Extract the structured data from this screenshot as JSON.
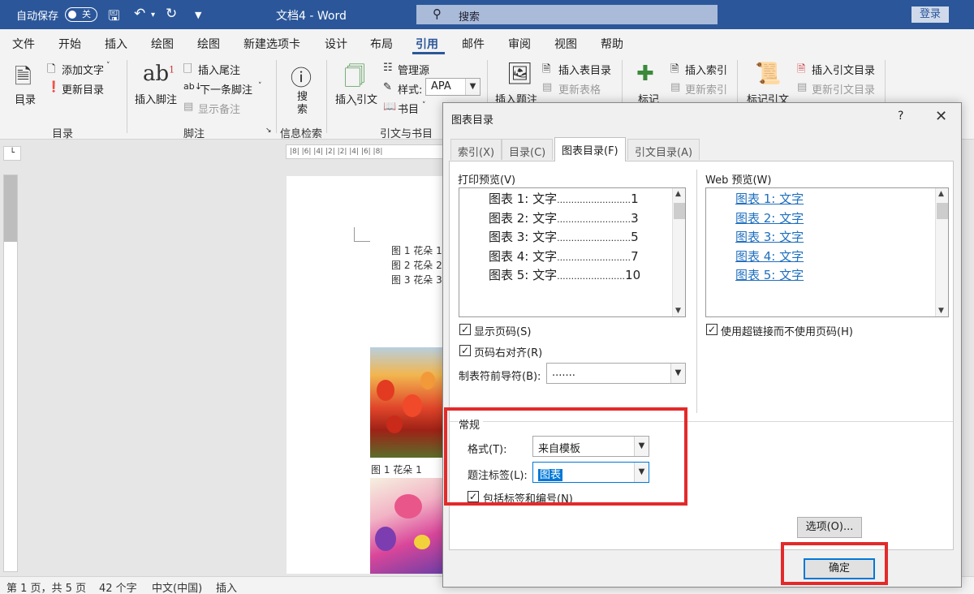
{
  "titlebar": {
    "autosave_label": "自动保存",
    "autosave_state": "关",
    "doc_title": "文档4 - Word",
    "search_placeholder": "搜索",
    "login": "登录"
  },
  "menu": {
    "items": [
      "文件",
      "开始",
      "插入",
      "绘图",
      "绘图",
      "新建选项卡",
      "设计",
      "布局",
      "引用",
      "邮件",
      "审阅",
      "视图",
      "帮助"
    ],
    "active_index": 8
  },
  "ribbon": {
    "toc": {
      "big": "目录",
      "add_text": "添加文字",
      "update": "更新目录",
      "group": "目录"
    },
    "footnote": {
      "insert": "插入脚注",
      "insert_endnote": "插入尾注",
      "next": "下一条脚注",
      "show": "显示备注",
      "group": "脚注"
    },
    "research": {
      "search": "搜索",
      "group": "信息检索"
    },
    "citations": {
      "insert": "插入引文",
      "manage": "管理源",
      "style_label": "样式:",
      "style_value": "APA",
      "bibliography": "书目",
      "group": "引文与书目"
    },
    "captions": {
      "insert": "插入题注",
      "insert_tof": "插入表目录",
      "update_table": "更新表格"
    },
    "index": {
      "mark": "标记",
      "insert": "插入索引",
      "update": "更新索引"
    },
    "toa": {
      "mark": "标记引文",
      "insert": "插入引文目录",
      "update": "更新引文目录"
    }
  },
  "document": {
    "toc_lines": [
      "图 1 花朵 1.",
      "图 2 花朵 2.",
      "图 3 花朵 3."
    ],
    "caption1": "图 1 花朵 1",
    "ruler_text": "|8|  |6|  |4|  |2|     |2|  |4|  |6|  |8|"
  },
  "statusbar": {
    "page": "第 1 页，共 5 页",
    "words": "42 个字",
    "language": "中文(中国)",
    "mode": "插入"
  },
  "dialog": {
    "title": "图表目录",
    "help": "?",
    "tabs": [
      "索引(X)",
      "目录(C)",
      "图表目录(F)",
      "引文目录(A)"
    ],
    "active_tab": 2,
    "print_preview_label": "打印预览(V)",
    "print_preview": [
      {
        "label": "图表  1:  文字",
        "dots": "..........................",
        "page": "1"
      },
      {
        "label": "图表  2:  文字",
        "dots": "..........................",
        "page": "3"
      },
      {
        "label": "图表  3:  文字",
        "dots": "..........................",
        "page": "5"
      },
      {
        "label": "图表  4:  文字",
        "dots": "..........................",
        "page": "7"
      },
      {
        "label": "图表  5:  文字",
        "dots": "........................",
        "page": "10"
      }
    ],
    "web_preview_label": "Web 预览(W)",
    "web_preview": [
      "图表  1:  文字",
      "图表  2:  文字",
      "图表  3:  文字",
      "图表  4:  文字",
      "图表  5:  文字"
    ],
    "show_page_numbers": "显示页码(S)",
    "right_align": "页码右对齐(R)",
    "tab_leader_label": "制表符前导符(B):",
    "tab_leader_value": ".......",
    "use_hyperlinks": "使用超链接而不使用页码(H)",
    "general_label": "常规",
    "format_label": "格式(T):",
    "format_value": "来自模板",
    "caption_label": "题注标签(L):",
    "caption_value": "图表",
    "include_label": "包括标签和编号(N)",
    "options_button": "选项(O)...",
    "ok_button": "确定"
  },
  "colors": {
    "word_blue": "#2b579a",
    "highlight_red": "#e32a2a",
    "selection_blue": "#0078d7",
    "link_blue": "#1f6fbf"
  }
}
